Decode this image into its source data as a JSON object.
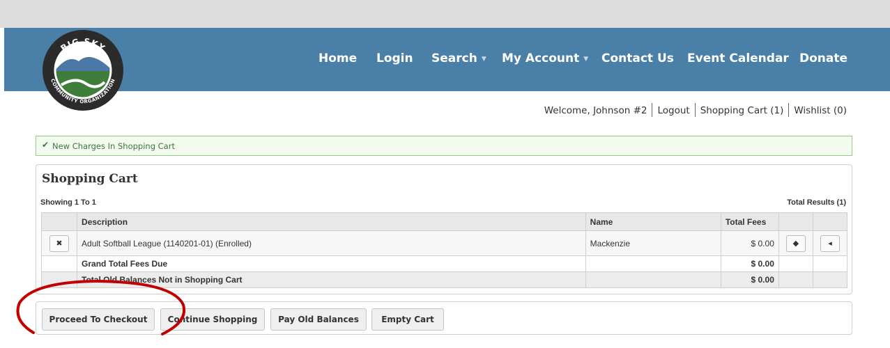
{
  "logo": {
    "top_text": "BIG SKY",
    "bottom_text": "COMMUNITY ORGANIZATION"
  },
  "nav": {
    "home": "Home",
    "login": "Login",
    "search": "Search",
    "my_account": "My Account",
    "contact_us": "Contact Us",
    "event_calendar": "Event Calendar",
    "donate": "Donate"
  },
  "userbar": {
    "welcome": "Welcome, Johnson #2",
    "logout": "Logout",
    "cart": "Shopping Cart (1)",
    "wishlist": "Wishlist (0)"
  },
  "alert": {
    "message": "New Charges In Shopping Cart"
  },
  "panel": {
    "title": "Shopping Cart",
    "showing": "Showing 1 To 1",
    "total_results": "Total Results (1)"
  },
  "table": {
    "headers": {
      "description": "Description",
      "name": "Name",
      "total_fees": "Total Fees"
    },
    "rows": [
      {
        "description": "Adult Softball League (1140201-01) (Enrolled)",
        "name": "Mackenzie",
        "fees": "$ 0.00"
      }
    ],
    "grand_total_label": "Grand Total Fees Due",
    "grand_total_value": "$ 0.00",
    "old_balances_label": "Total Old Balances Not in Shopping Cart",
    "old_balances_value": "$ 0.00"
  },
  "actions": {
    "checkout": "Proceed To Checkout",
    "continue": "Continue Shopping",
    "pay_old": "Pay Old Balances",
    "empty": "Empty Cart"
  },
  "colors": {
    "nav_bg": "#4a7fa8",
    "alert_border": "#8fcf7e",
    "annotation": "#c00000"
  }
}
